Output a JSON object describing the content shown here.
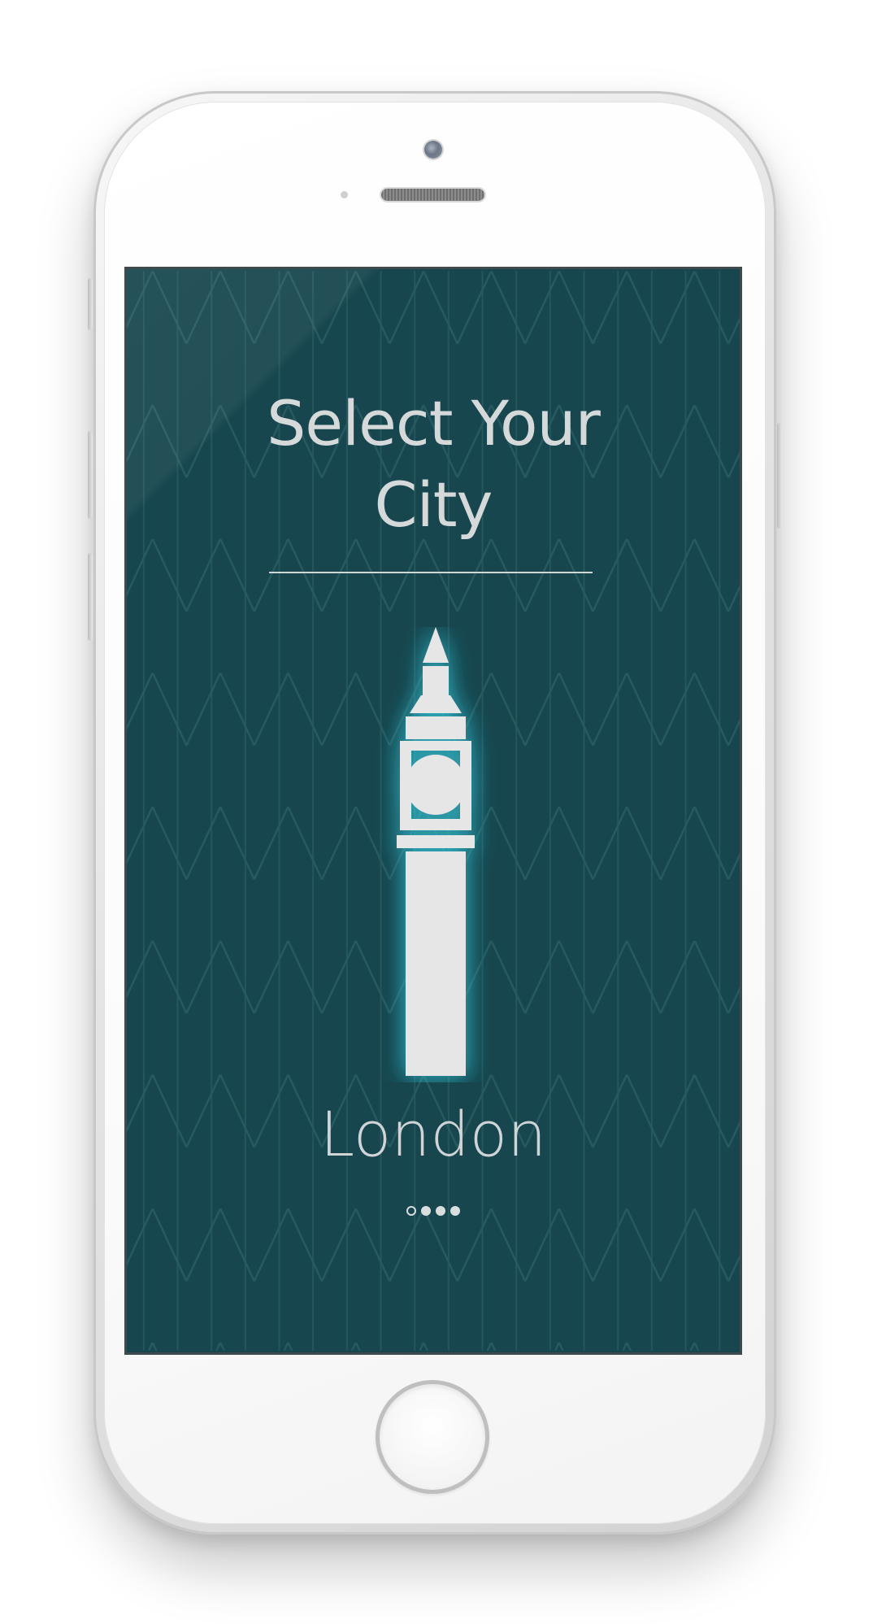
{
  "screen": {
    "title_line1": "Select Your",
    "title_line2": "City",
    "city_name": "London",
    "landmark_icon": "big-ben-icon",
    "pagination": {
      "total": 4,
      "current": 1
    }
  },
  "colors": {
    "screen_background": "#17464e",
    "text": "#d5d9d9",
    "icon_fill": "#e6e6e6",
    "glow": "#36c3d6"
  }
}
